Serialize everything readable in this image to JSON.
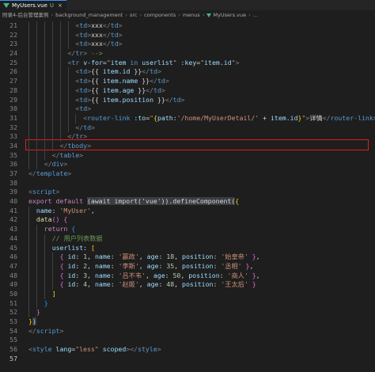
{
  "tabs": [
    {
      "label": "MyUsers.vue",
      "modified_marker": "U",
      "close": "×"
    }
  ],
  "breadcrumb": {
    "items": [
      "附录4-后台管理案例",
      "background_management",
      "src",
      "components",
      "menus",
      "MyUsers.vue",
      "..."
    ],
    "separator": "›"
  },
  "editor": {
    "highlight_line": 31,
    "lines": [
      {
        "n": "21",
        "indent": 6,
        "tokens": [
          [
            "t",
            "<"
          ],
          [
            "tag",
            "td"
          ],
          [
            "t",
            ">"
          ],
          [
            "w",
            "xxx"
          ],
          [
            "t",
            "</"
          ],
          [
            "tag",
            "td"
          ],
          [
            "t",
            ">"
          ]
        ]
      },
      {
        "n": "22",
        "indent": 6,
        "tokens": [
          [
            "t",
            "<"
          ],
          [
            "tag",
            "td"
          ],
          [
            "t",
            ">"
          ],
          [
            "w",
            "xxx"
          ],
          [
            "t",
            "</"
          ],
          [
            "tag",
            "td"
          ],
          [
            "t",
            ">"
          ]
        ]
      },
      {
        "n": "23",
        "indent": 6,
        "tokens": [
          [
            "t",
            "<"
          ],
          [
            "tag",
            "td"
          ],
          [
            "t",
            ">"
          ],
          [
            "w",
            "xxx"
          ],
          [
            "t",
            "</"
          ],
          [
            "tag",
            "td"
          ],
          [
            "t",
            ">"
          ]
        ]
      },
      {
        "n": "24",
        "indent": 5,
        "tokens": [
          [
            "t",
            "</"
          ],
          [
            "tag",
            "tr"
          ],
          [
            "t",
            "> "
          ],
          [
            "cm",
            "-->"
          ]
        ]
      },
      {
        "n": "25",
        "indent": 5,
        "tokens": [
          [
            "t",
            "<"
          ],
          [
            "tag",
            "tr"
          ],
          [
            "w",
            " "
          ],
          [
            "a",
            "v-for"
          ],
          [
            "w",
            "="
          ],
          [
            "s",
            "\""
          ],
          [
            "a",
            "item"
          ],
          [
            "w",
            " "
          ],
          [
            "kb",
            "in"
          ],
          [
            "w",
            " "
          ],
          [
            "a",
            "userlist"
          ],
          [
            "s",
            "\""
          ],
          [
            "w",
            " "
          ],
          [
            "a",
            ":key"
          ],
          [
            "w",
            "="
          ],
          [
            "s",
            "\""
          ],
          [
            "a",
            "item"
          ],
          [
            "w",
            "."
          ],
          [
            "a",
            "id"
          ],
          [
            "s",
            "\""
          ],
          [
            "t",
            ">"
          ]
        ]
      },
      {
        "n": "26",
        "indent": 6,
        "tokens": [
          [
            "t",
            "<"
          ],
          [
            "tag",
            "td"
          ],
          [
            "t",
            ">"
          ],
          [
            "w",
            "{{ "
          ],
          [
            "a",
            "item"
          ],
          [
            "w",
            "."
          ],
          [
            "a",
            "id"
          ],
          [
            "w",
            " }}"
          ],
          [
            "t",
            "</"
          ],
          [
            "tag",
            "td"
          ],
          [
            "t",
            ">"
          ]
        ]
      },
      {
        "n": "27",
        "indent": 6,
        "tokens": [
          [
            "t",
            "<"
          ],
          [
            "tag",
            "td"
          ],
          [
            "t",
            ">"
          ],
          [
            "w",
            "{{ "
          ],
          [
            "a",
            "item"
          ],
          [
            "w",
            "."
          ],
          [
            "a",
            "name"
          ],
          [
            "w",
            " }}"
          ],
          [
            "t",
            "</"
          ],
          [
            "tag",
            "td"
          ],
          [
            "t",
            ">"
          ]
        ]
      },
      {
        "n": "28",
        "indent": 6,
        "tokens": [
          [
            "t",
            "<"
          ],
          [
            "tag",
            "td"
          ],
          [
            "t",
            ">"
          ],
          [
            "w",
            "{{ "
          ],
          [
            "a",
            "item"
          ],
          [
            "w",
            "."
          ],
          [
            "a",
            "age"
          ],
          [
            "w",
            " }}"
          ],
          [
            "t",
            "</"
          ],
          [
            "tag",
            "td"
          ],
          [
            "t",
            ">"
          ]
        ]
      },
      {
        "n": "29",
        "indent": 6,
        "tokens": [
          [
            "t",
            "<"
          ],
          [
            "tag",
            "td"
          ],
          [
            "t",
            ">"
          ],
          [
            "w",
            "{{ "
          ],
          [
            "a",
            "item"
          ],
          [
            "w",
            "."
          ],
          [
            "a",
            "position"
          ],
          [
            "w",
            " }}"
          ],
          [
            "t",
            "</"
          ],
          [
            "tag",
            "td"
          ],
          [
            "t",
            ">"
          ]
        ]
      },
      {
        "n": "30",
        "indent": 6,
        "tokens": [
          [
            "t",
            "<"
          ],
          [
            "tag",
            "td"
          ],
          [
            "t",
            ">"
          ]
        ]
      },
      {
        "n": "31",
        "indent": 7,
        "tokens": [
          [
            "t",
            "<"
          ],
          [
            "tag",
            "router-link"
          ],
          [
            "w",
            " "
          ],
          [
            "a",
            ":to"
          ],
          [
            "w",
            "="
          ],
          [
            "s",
            "\""
          ],
          [
            "py",
            "{"
          ],
          [
            "a",
            "path"
          ],
          [
            "w",
            ":"
          ],
          [
            "s",
            "'/home/MyUserDetail/'"
          ],
          [
            "w",
            " + "
          ],
          [
            "a",
            "item"
          ],
          [
            "w",
            "."
          ],
          [
            "a",
            "id"
          ],
          [
            "py",
            "}"
          ],
          [
            "s",
            "\""
          ],
          [
            "t",
            ">"
          ],
          [
            "w",
            "详情"
          ],
          [
            "t",
            "</"
          ],
          [
            "tag",
            "router-link"
          ],
          [
            "t",
            ">"
          ]
        ]
      },
      {
        "n": "32",
        "indent": 6,
        "tokens": [
          [
            "t",
            "</"
          ],
          [
            "tag",
            "td"
          ],
          [
            "t",
            ">"
          ]
        ]
      },
      {
        "n": "33",
        "indent": 5,
        "tokens": [
          [
            "t",
            "</"
          ],
          [
            "tag",
            "tr"
          ],
          [
            "t",
            ">"
          ]
        ]
      },
      {
        "n": "34",
        "indent": 4,
        "tokens": [
          [
            "t",
            "</"
          ],
          [
            "tag",
            "tbody"
          ],
          [
            "t",
            ">"
          ]
        ]
      },
      {
        "n": "35",
        "indent": 3,
        "tokens": [
          [
            "t",
            "</"
          ],
          [
            "tag",
            "table"
          ],
          [
            "t",
            ">"
          ]
        ]
      },
      {
        "n": "36",
        "indent": 2,
        "tokens": [
          [
            "t",
            "</"
          ],
          [
            "tag",
            "div"
          ],
          [
            "t",
            ">"
          ]
        ]
      },
      {
        "n": "37",
        "indent": 0,
        "tokens": [
          [
            "t",
            "</"
          ],
          [
            "tag",
            "template"
          ],
          [
            "t",
            ">"
          ]
        ]
      },
      {
        "n": "38",
        "indent": 0,
        "tokens": []
      },
      {
        "n": "39",
        "indent": 0,
        "tokens": [
          [
            "t",
            "<"
          ],
          [
            "tag",
            "script"
          ],
          [
            "t",
            ">"
          ]
        ]
      },
      {
        "n": "40",
        "indent": 0,
        "tokens": [
          [
            "kw",
            "export"
          ],
          [
            "w",
            " "
          ],
          [
            "kw",
            "default"
          ],
          [
            "w",
            " "
          ],
          [
            "inl",
            "(await import('vue')).defineComponent("
          ],
          [
            "py",
            "{"
          ]
        ]
      },
      {
        "n": "41",
        "indent": 1,
        "tokens": [
          [
            "a",
            "name"
          ],
          [
            "w",
            ": "
          ],
          [
            "s",
            "'MyUser'"
          ],
          [
            "w",
            ","
          ]
        ]
      },
      {
        "n": "42",
        "indent": 1,
        "tokens": [
          [
            "fn",
            "data"
          ],
          [
            "pn",
            "()"
          ],
          [
            "w",
            " "
          ],
          [
            "pn",
            "{"
          ]
        ]
      },
      {
        "n": "43",
        "indent": 2,
        "tokens": [
          [
            "kw",
            "return"
          ],
          [
            "w",
            " "
          ],
          [
            "pb",
            "{"
          ]
        ]
      },
      {
        "n": "44",
        "indent": 3,
        "tokens": [
          [
            "cm",
            "// 用户列表数据"
          ]
        ]
      },
      {
        "n": "45",
        "indent": 3,
        "tokens": [
          [
            "a",
            "userlist"
          ],
          [
            "w",
            ": "
          ],
          [
            "py",
            "["
          ]
        ]
      },
      {
        "n": "46",
        "indent": 4,
        "tokens": [
          [
            "pn",
            "{"
          ],
          [
            "w",
            " "
          ],
          [
            "a",
            "id"
          ],
          [
            "w",
            ": "
          ],
          [
            "num",
            "1"
          ],
          [
            "w",
            ", "
          ],
          [
            "a",
            "name"
          ],
          [
            "w",
            ": "
          ],
          [
            "s",
            "'嬴政'"
          ],
          [
            "w",
            ", "
          ],
          [
            "a",
            "age"
          ],
          [
            "w",
            ": "
          ],
          [
            "num",
            "18"
          ],
          [
            "w",
            ", "
          ],
          [
            "a",
            "position"
          ],
          [
            "w",
            ": "
          ],
          [
            "s",
            "'始皇帝'"
          ],
          [
            "w",
            " "
          ],
          [
            "pn",
            "}"
          ],
          [
            "w",
            ","
          ]
        ]
      },
      {
        "n": "47",
        "indent": 4,
        "tokens": [
          [
            "pn",
            "{"
          ],
          [
            "w",
            " "
          ],
          [
            "a",
            "id"
          ],
          [
            "w",
            ": "
          ],
          [
            "num",
            "2"
          ],
          [
            "w",
            ", "
          ],
          [
            "a",
            "name"
          ],
          [
            "w",
            ": "
          ],
          [
            "s",
            "'李斯'"
          ],
          [
            "w",
            ", "
          ],
          [
            "a",
            "age"
          ],
          [
            "w",
            ": "
          ],
          [
            "num",
            "35"
          ],
          [
            "w",
            ", "
          ],
          [
            "a",
            "position"
          ],
          [
            "w",
            ": "
          ],
          [
            "s",
            "'丞相'"
          ],
          [
            "w",
            " "
          ],
          [
            "pn",
            "}"
          ],
          [
            "w",
            ","
          ]
        ]
      },
      {
        "n": "48",
        "indent": 4,
        "tokens": [
          [
            "pn",
            "{"
          ],
          [
            "w",
            " "
          ],
          [
            "a",
            "id"
          ],
          [
            "w",
            ": "
          ],
          [
            "num",
            "3"
          ],
          [
            "w",
            ", "
          ],
          [
            "a",
            "name"
          ],
          [
            "w",
            ": "
          ],
          [
            "s",
            "'吕不韦'"
          ],
          [
            "w",
            ", "
          ],
          [
            "a",
            "age"
          ],
          [
            "w",
            ": "
          ],
          [
            "num",
            "50"
          ],
          [
            "w",
            ", "
          ],
          [
            "a",
            "position"
          ],
          [
            "w",
            ": "
          ],
          [
            "s",
            "'商人'"
          ],
          [
            "w",
            " "
          ],
          [
            "pn",
            "}"
          ],
          [
            "w",
            ","
          ]
        ]
      },
      {
        "n": "49",
        "indent": 4,
        "tokens": [
          [
            "pn",
            "{"
          ],
          [
            "w",
            " "
          ],
          [
            "a",
            "id"
          ],
          [
            "w",
            ": "
          ],
          [
            "num",
            "4"
          ],
          [
            "w",
            ", "
          ],
          [
            "a",
            "name"
          ],
          [
            "w",
            ": "
          ],
          [
            "s",
            "'赵姬'"
          ],
          [
            "w",
            ", "
          ],
          [
            "a",
            "age"
          ],
          [
            "w",
            ": "
          ],
          [
            "num",
            "48"
          ],
          [
            "w",
            ", "
          ],
          [
            "a",
            "position"
          ],
          [
            "w",
            ": "
          ],
          [
            "s",
            "'王太后'"
          ],
          [
            "w",
            " "
          ],
          [
            "pn",
            "}"
          ]
        ]
      },
      {
        "n": "50",
        "indent": 3,
        "tokens": [
          [
            "py",
            "]"
          ]
        ]
      },
      {
        "n": "51",
        "indent": 2,
        "tokens": [
          [
            "pb",
            "}"
          ]
        ]
      },
      {
        "n": "52",
        "indent": 1,
        "tokens": [
          [
            "pn",
            "}"
          ]
        ]
      },
      {
        "n": "53",
        "indent": 0,
        "tokens": [
          [
            "py",
            "}"
          ],
          [
            "inl",
            ")"
          ]
        ]
      },
      {
        "n": "54",
        "indent": 0,
        "tokens": [
          [
            "t",
            "</"
          ],
          [
            "tag",
            "script"
          ],
          [
            "t",
            ">"
          ]
        ]
      },
      {
        "n": "55",
        "indent": 0,
        "tokens": []
      },
      {
        "n": "56",
        "indent": 0,
        "tokens": [
          [
            "t",
            "<"
          ],
          [
            "tag",
            "style"
          ],
          [
            "w",
            " "
          ],
          [
            "a",
            "lang"
          ],
          [
            "w",
            "="
          ],
          [
            "s",
            "\"less\""
          ],
          [
            "w",
            " "
          ],
          [
            "a",
            "scoped"
          ],
          [
            "t",
            "></"
          ],
          [
            "tag",
            "style"
          ],
          [
            "t",
            ">"
          ]
        ]
      },
      {
        "n": "57",
        "indent": 0,
        "tokens": []
      }
    ]
  }
}
